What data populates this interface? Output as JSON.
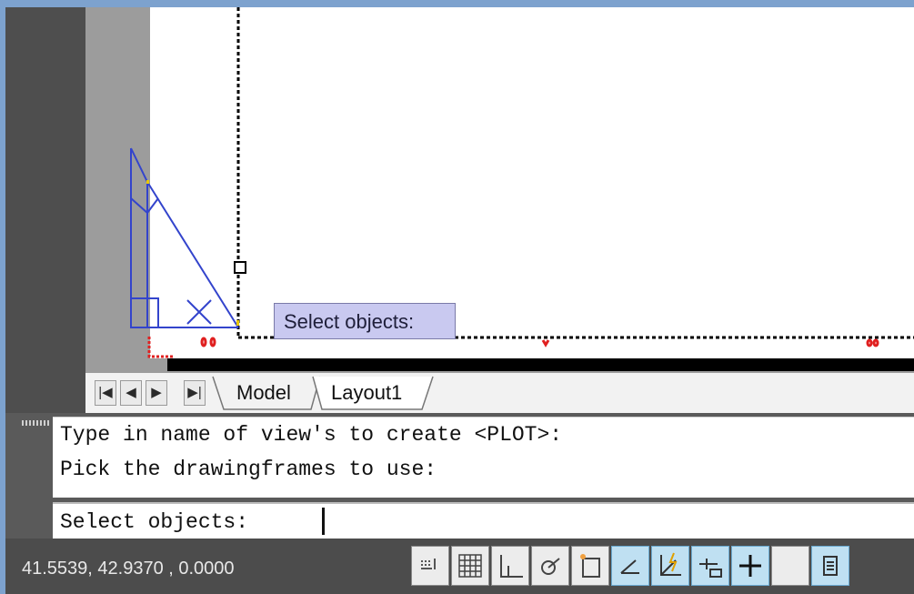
{
  "drawing": {
    "tooltip": "Select objects:"
  },
  "layout_tabs": {
    "nav": [
      "|◀",
      "◀",
      "▶",
      "▶|"
    ],
    "tabs": [
      {
        "label": "Model",
        "active": false
      },
      {
        "label": "Layout1",
        "active": true
      }
    ]
  },
  "command_line": {
    "history": [
      "Type in name of view's to create <PLOT>:",
      "Pick the drawingframes to use:"
    ],
    "prompt": "Select objects: "
  },
  "status_bar": {
    "coordinates": "41.5539, 42.9370 , 0.0000",
    "toggles": [
      {
        "icon": "infer-constraints-icon",
        "on": false
      },
      {
        "icon": "snap-grid-icon",
        "on": false
      },
      {
        "icon": "grid-display-icon",
        "on": false
      },
      {
        "icon": "ortho-mode-icon",
        "on": false
      },
      {
        "icon": "polar-tracking-icon",
        "on": false
      },
      {
        "icon": "object-snap-icon",
        "on": false
      },
      {
        "icon": "object-snap-tracking-icon",
        "on": true
      },
      {
        "icon": "dynamic-ucs-icon",
        "on": true
      },
      {
        "icon": "dynamic-input-icon",
        "on": true
      },
      {
        "icon": "lineweight-icon",
        "on": false
      },
      {
        "icon": "quick-properties-icon",
        "on": true
      }
    ]
  },
  "colors": {
    "window_border": "#7da2ce",
    "tooltip_bg": "#c9c9f0",
    "toggle_on": "#bfe0f2",
    "drawing_blue": "#3344cc"
  }
}
